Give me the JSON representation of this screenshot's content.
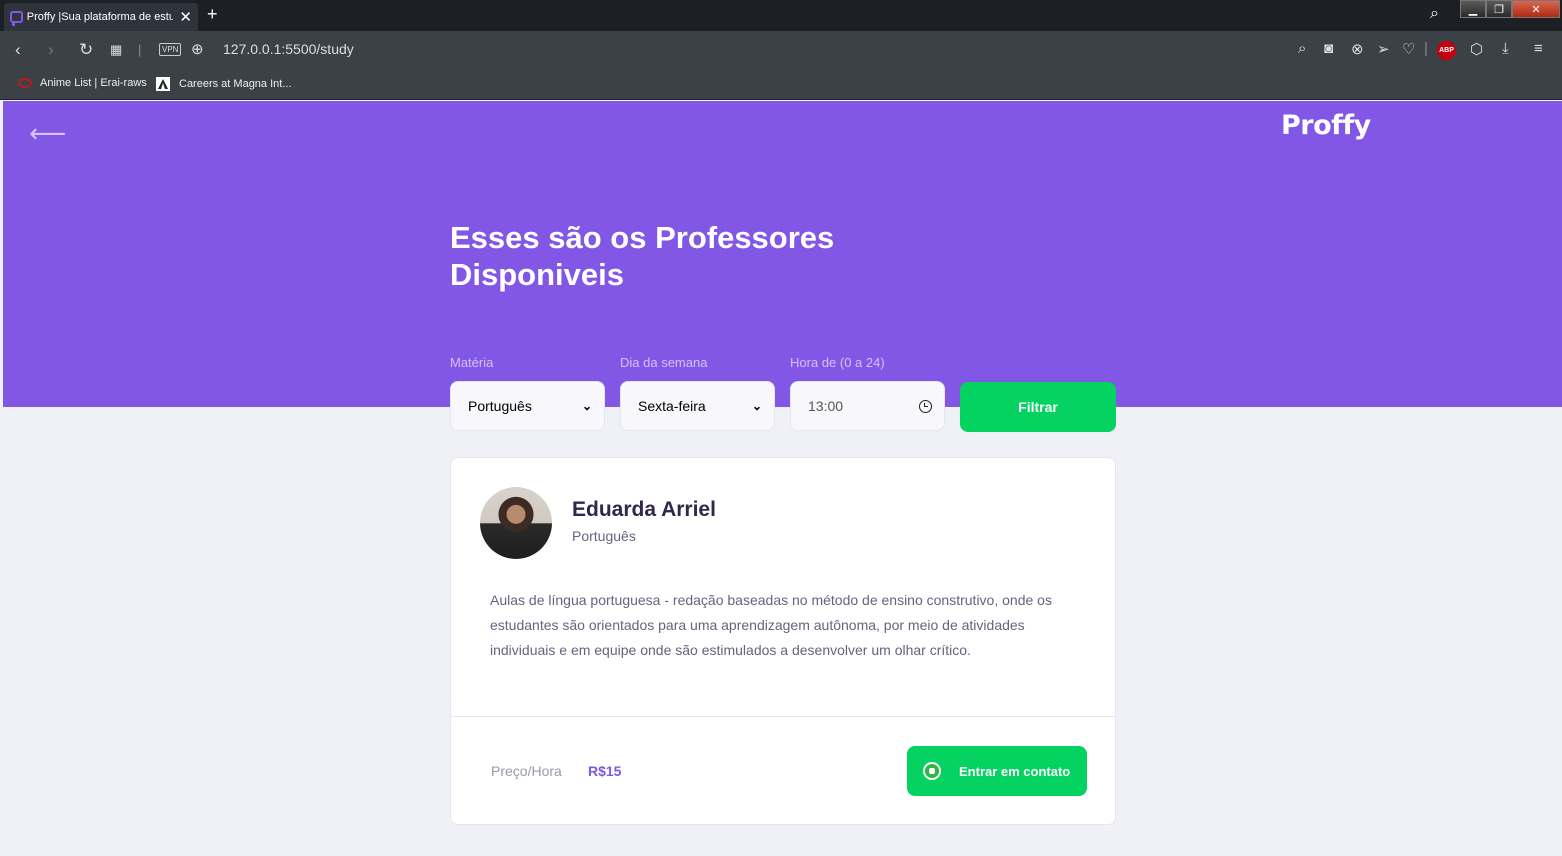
{
  "browser": {
    "tab_title": "Proffy |Sua plataforma de estudos",
    "url": "127.0.0.1:5500/study",
    "vpn_label": "VPN",
    "abp_label": "ABP",
    "bookmarks": [
      "Anime List | Erai-raws",
      "Careers at Magna Int..."
    ]
  },
  "header": {
    "back_arrow": "⟵",
    "logo": "Proffy",
    "title": "Esses são os Professores Disponiveis"
  },
  "filters": {
    "subject_label": "Matéria",
    "subject_value": "Português",
    "weekday_label": "Dia da semana",
    "weekday_value": "Sexta-feira",
    "time_label": "Hora de (0 a 24)",
    "time_value": "13:00",
    "submit_label": "Filtrar"
  },
  "teacher": {
    "name": "Eduarda Arriel",
    "subject": "Português",
    "bio": "Aulas de língua portuguesa - redação baseadas no método de ensino construtivo, onde os estudantes são orientados para uma aprendizagem autônoma, por meio de atividades individuais e em equipe onde são estimulados a desenvolver um olhar crítico.",
    "price_label": "Preço/Hora",
    "price_value": "R$15",
    "contact_label": "Entrar em contato"
  },
  "colors": {
    "primary": "#8257e5",
    "secondary": "#04d361",
    "background": "#f0f0f7"
  }
}
